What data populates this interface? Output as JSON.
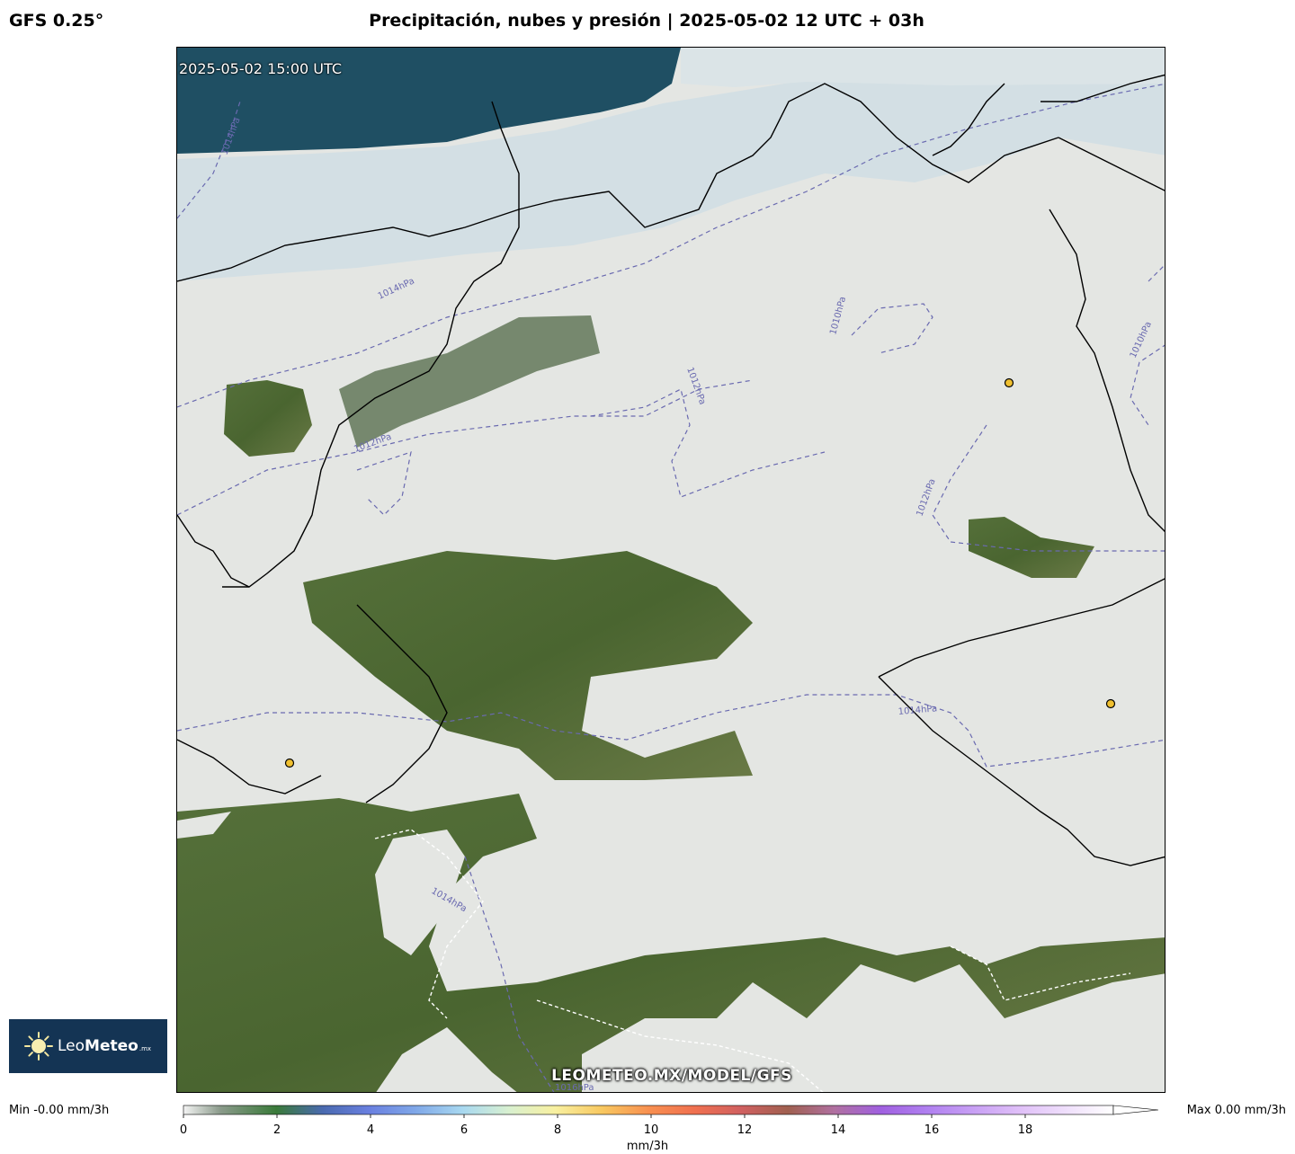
{
  "header": {
    "model": "GFS 0.25°",
    "title": "Precipitación, nubes y presión | 2025-05-02 12 UTC + 03h"
  },
  "map": {
    "valid_time": "2025-05-02 15:00 UTC",
    "watermark": "LEOMETEO.MX/MODEL/GFS",
    "isobar_labels": [
      {
        "text": "1014hPa"
      },
      {
        "text": "1014hPa"
      },
      {
        "text": "1012hPa"
      },
      {
        "text": "1012hPa"
      },
      {
        "text": "1012hPa"
      },
      {
        "text": "1010hPa"
      },
      {
        "text": "1010hPa"
      },
      {
        "text": "1014hPa"
      },
      {
        "text": "1014hPa"
      },
      {
        "text": "1016hPa"
      }
    ],
    "colors": {
      "sea": "#1f4f63",
      "sea_ice_cloud": "#d3dfe4",
      "land": "#4f6a34",
      "cloud": "#e6e8e6",
      "isobar": "#6a6ab0",
      "border": "#000000",
      "city_marker": "#f0c030"
    }
  },
  "logo": {
    "name_light": "Leo",
    "name_bold": "Meteo",
    "suffix": ".mx"
  },
  "colorbar": {
    "min_label": "Min -0.00 mm/3h",
    "max_label": "Max 0.00 mm/3h",
    "unit": "mm/3h",
    "range": [
      0,
      20
    ],
    "ticks": [
      "0",
      "2",
      "4",
      "6",
      "8",
      "10",
      "12",
      "14",
      "16",
      "18"
    ]
  }
}
